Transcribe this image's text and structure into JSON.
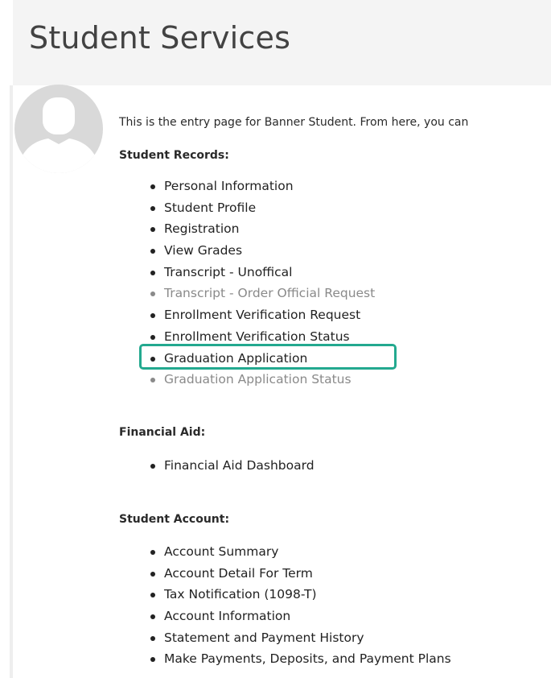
{
  "page": {
    "title": "Student Services",
    "intro": "This is the entry page for Banner Student. From here, you can"
  },
  "sections": {
    "student_records": {
      "heading": "Student Records:",
      "items": [
        {
          "label": "Personal Information",
          "muted": false
        },
        {
          "label": "Student Profile",
          "muted": false
        },
        {
          "label": "Registration",
          "muted": false
        },
        {
          "label": "View Grades",
          "muted": false
        },
        {
          "label": "Transcript - Unoffical",
          "muted": false
        },
        {
          "label": "Transcript - Order Official Request",
          "muted": true
        },
        {
          "label": "Enrollment Verification Request",
          "muted": false
        },
        {
          "label": "Enrollment Verification Status",
          "muted": false
        },
        {
          "label": "Graduation Application",
          "muted": false
        },
        {
          "label": "Graduation Application Status",
          "muted": true
        }
      ]
    },
    "financial_aid": {
      "heading": "Financial Aid:",
      "items": [
        {
          "label": "Financial Aid Dashboard",
          "muted": false
        }
      ]
    },
    "student_account": {
      "heading": "Student Account:",
      "items": [
        {
          "label": "Account Summary",
          "muted": false
        },
        {
          "label": "Account Detail For Term",
          "muted": false
        },
        {
          "label": "Tax Notification (1098-T)",
          "muted": false
        },
        {
          "label": "Account Information",
          "muted": false
        },
        {
          "label": "Statement and Payment History",
          "muted": false
        },
        {
          "label": "Make Payments, Deposits, and Payment Plans",
          "muted": false
        }
      ]
    }
  },
  "highlight": {
    "target": "Graduation Application",
    "color": "#23a98f"
  },
  "colors": {
    "header_background": "#f4f4f4",
    "title_text": "#424242",
    "muted_text": "#8a8a8a",
    "avatar_background": "#d9d9d9",
    "avatar_silhouette": "#ffffff"
  },
  "icons": {
    "avatar": "default-user-avatar-icon"
  }
}
